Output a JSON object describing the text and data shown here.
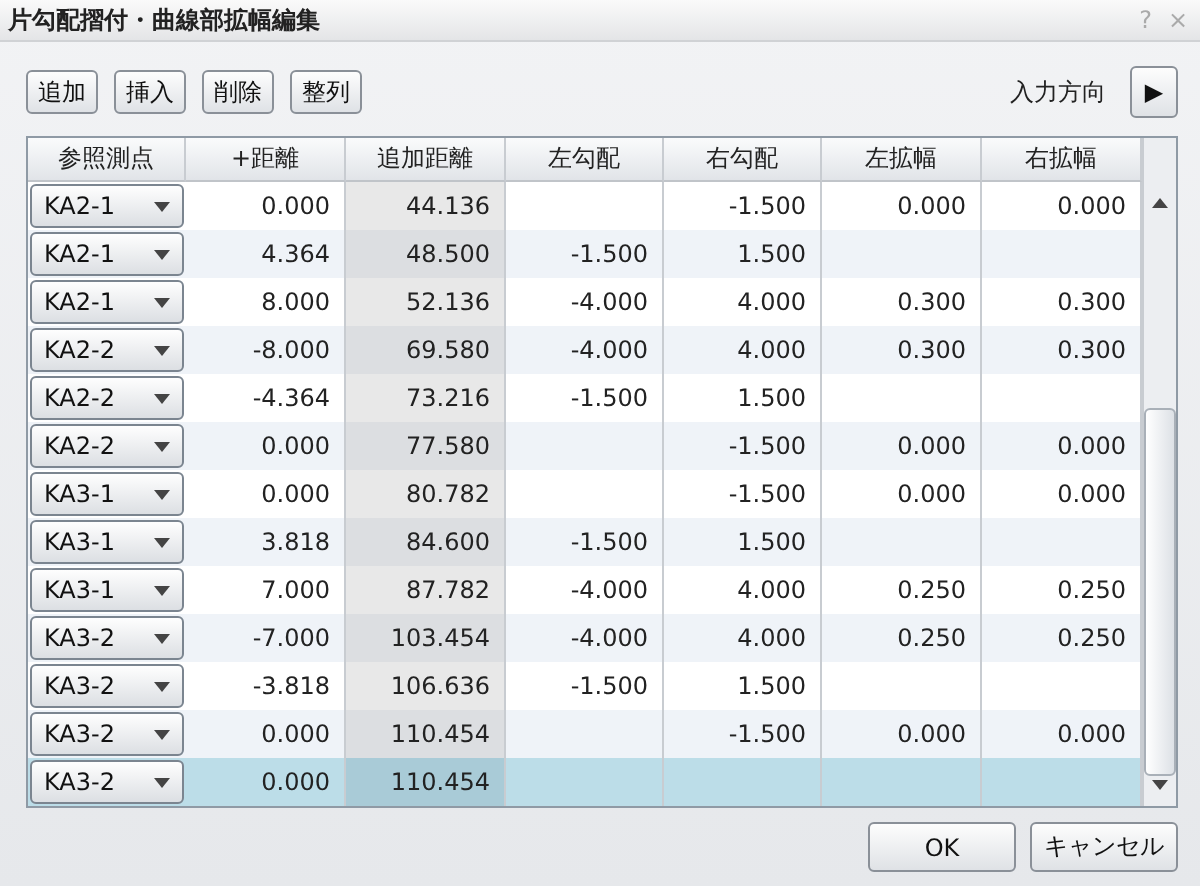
{
  "window": {
    "title": "片勾配摺付・曲線部拡幅編集",
    "help": "?",
    "close": "×"
  },
  "toolbar": {
    "buttons": [
      "追加",
      "挿入",
      "削除",
      "整列"
    ],
    "direction_label": "入力方向",
    "direction_button": "▶"
  },
  "table": {
    "columns": [
      "参照測点",
      "+距離",
      "追加距離",
      "左勾配",
      "右勾配",
      "左拡幅",
      "右拡幅"
    ],
    "rows": [
      {
        "selected": false,
        "ref": "KA2-1",
        "plus_distance": "0.000",
        "added_distance": "44.136",
        "right_slope": "-1.500",
        "left_widening": "0.000",
        "right_widening": "0.000"
      },
      {
        "selected": false,
        "ref": "KA2-1",
        "plus_distance": "4.364",
        "added_distance": "48.500",
        "left_slope": "-1.500",
        "right_slope": "1.500"
      },
      {
        "selected": false,
        "ref": "KA2-1",
        "plus_distance": "8.000",
        "added_distance": "52.136",
        "left_slope": "-4.000",
        "right_slope": "4.000",
        "left_widening": "0.300",
        "right_widening": "0.300"
      },
      {
        "selected": false,
        "ref": "KA2-2",
        "plus_distance": "-8.000",
        "added_distance": "69.580",
        "left_slope": "-4.000",
        "right_slope": "4.000",
        "left_widening": "0.300",
        "right_widening": "0.300"
      },
      {
        "selected": false,
        "ref": "KA2-2",
        "plus_distance": "-4.364",
        "added_distance": "73.216",
        "left_slope": "-1.500",
        "right_slope": "1.500"
      },
      {
        "selected": false,
        "ref": "KA2-2",
        "plus_distance": "0.000",
        "added_distance": "77.580",
        "right_slope": "-1.500",
        "left_widening": "0.000",
        "right_widening": "0.000"
      },
      {
        "selected": false,
        "ref": "KA3-1",
        "plus_distance": "0.000",
        "added_distance": "80.782",
        "right_slope": "-1.500",
        "left_widening": "0.000",
        "right_widening": "0.000"
      },
      {
        "selected": false,
        "ref": "KA3-1",
        "plus_distance": "3.818",
        "added_distance": "84.600",
        "left_slope": "-1.500",
        "right_slope": "1.500"
      },
      {
        "selected": false,
        "ref": "KA3-1",
        "plus_distance": "7.000",
        "added_distance": "87.782",
        "left_slope": "-4.000",
        "right_slope": "4.000",
        "left_widening": "0.250",
        "right_widening": "0.250"
      },
      {
        "selected": false,
        "ref": "KA3-2",
        "plus_distance": "-7.000",
        "added_distance": "103.454",
        "left_slope": "-4.000",
        "right_slope": "4.000",
        "left_widening": "0.250",
        "right_widening": "0.250"
      },
      {
        "selected": false,
        "ref": "KA3-2",
        "plus_distance": "-3.818",
        "added_distance": "106.636",
        "left_slope": "-1.500",
        "right_slope": "1.500"
      },
      {
        "selected": false,
        "ref": "KA3-2",
        "plus_distance": "0.000",
        "added_distance": "110.454",
        "right_slope": "-1.500",
        "left_widening": "0.000",
        "right_widening": "0.000"
      },
      {
        "selected": true,
        "ref": "KA3-2",
        "plus_distance": "0.000",
        "added_distance": "110.454"
      }
    ]
  },
  "footer": {
    "buttons": [
      "OK",
      "キャンセル"
    ]
  }
}
